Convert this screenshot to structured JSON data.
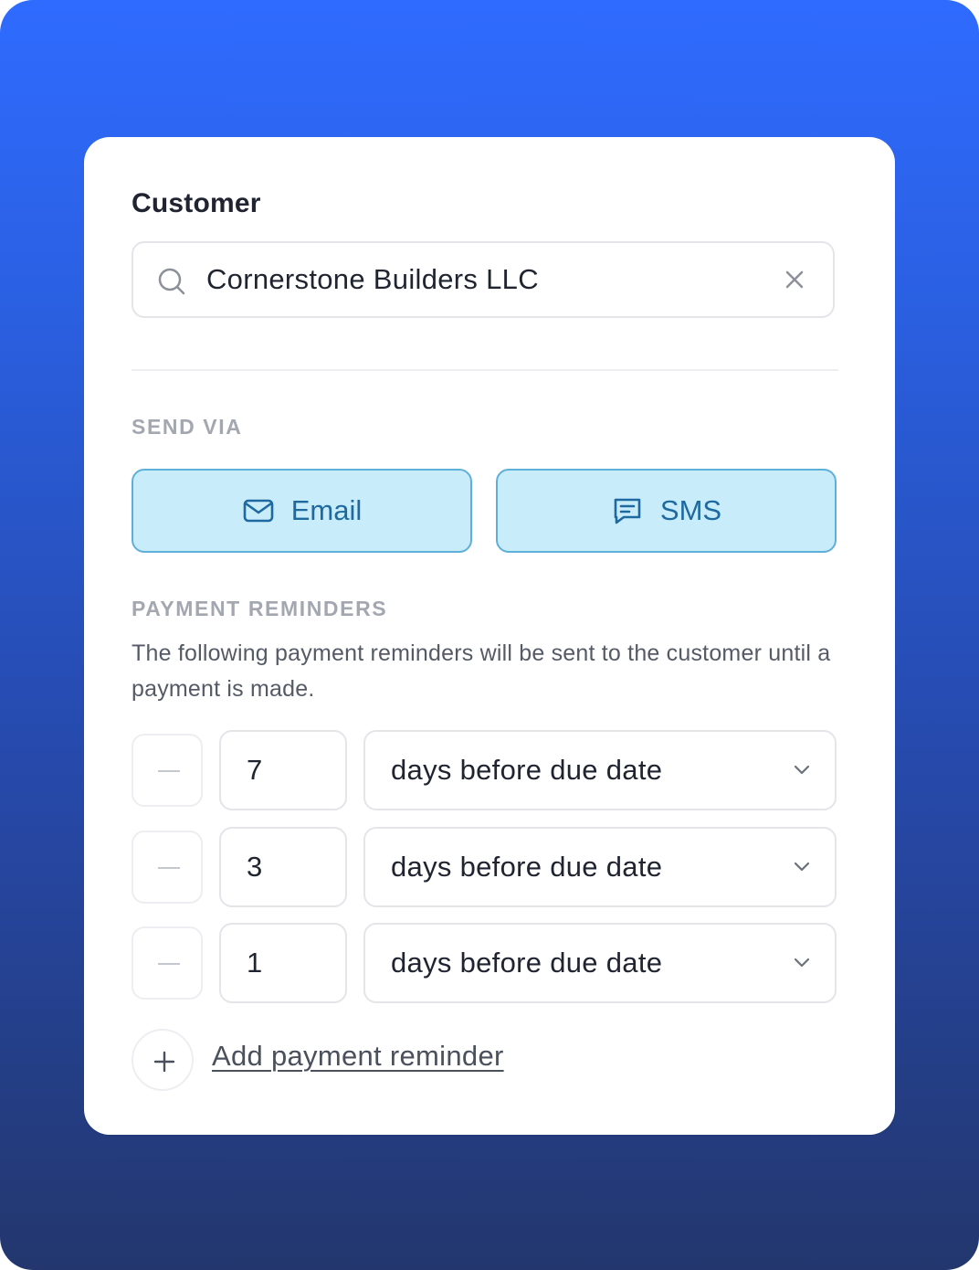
{
  "customer": {
    "label": "Customer",
    "search_value": "Cornerstone Builders LLC"
  },
  "send_via": {
    "label": "SEND VIA",
    "channels": [
      {
        "label": "Email",
        "icon": "mail-icon"
      },
      {
        "label": "SMS",
        "icon": "chat-icon"
      }
    ]
  },
  "reminders": {
    "label": "PAYMENT REMINDERS",
    "description": "The following payment reminders will be sent to the customer until a payment is made.",
    "items": [
      {
        "days": "7",
        "when": "days before due date"
      },
      {
        "days": "3",
        "when": "days before due date"
      },
      {
        "days": "1",
        "when": "days before due date"
      }
    ],
    "add_label": "Add payment reminder"
  },
  "colors": {
    "background_top": "#2f6bff",
    "background_bottom": "#23376e",
    "channel_fill": "#c8ecfa",
    "channel_border": "#5fb0d8",
    "channel_text": "#1e6aa0"
  }
}
